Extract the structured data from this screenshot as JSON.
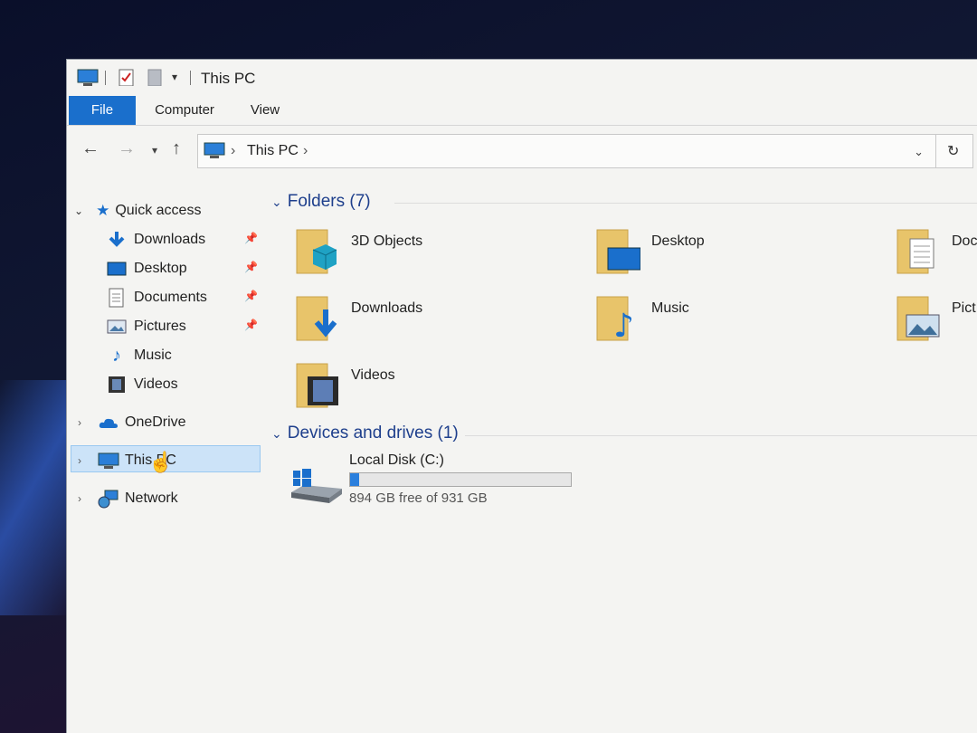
{
  "window": {
    "title": "This PC"
  },
  "ribbon": {
    "tabs": [
      "File",
      "Computer",
      "View"
    ]
  },
  "address": {
    "crumb": "This PC"
  },
  "sidebar": {
    "quick_access": "Quick access",
    "items": [
      {
        "label": "Downloads",
        "icon": "download-arrow-icon",
        "pinned": true
      },
      {
        "label": "Desktop",
        "icon": "desktop-icon",
        "pinned": true
      },
      {
        "label": "Documents",
        "icon": "document-icon",
        "pinned": true
      },
      {
        "label": "Pictures",
        "icon": "picture-icon",
        "pinned": true
      },
      {
        "label": "Music",
        "icon": "music-note-icon",
        "pinned": false
      },
      {
        "label": "Videos",
        "icon": "film-icon",
        "pinned": false
      }
    ],
    "onedrive": "OneDrive",
    "this_pc": "This PC",
    "network": "Network"
  },
  "main": {
    "folders_header": "Folders (7)",
    "folders": [
      "3D Objects",
      "Desktop",
      "Doc",
      "Downloads",
      "Music",
      "Pict",
      "Videos"
    ],
    "devices_header": "Devices and drives (1)",
    "drive": {
      "name": "Local Disk (C:)",
      "free_text": "894 GB free of 931 GB",
      "used_fraction": 0.04
    }
  },
  "colors": {
    "accent": "#1a6fcc",
    "header_text": "#1e3f8c",
    "selection": "#cce3f8",
    "folder": "#e8c46a"
  }
}
